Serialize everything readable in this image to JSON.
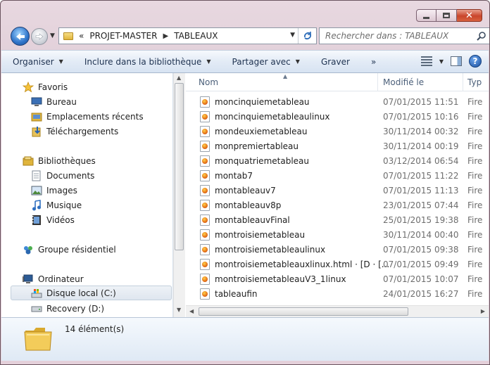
{
  "address": {
    "chevrons": "«",
    "crumbs": [
      "PROJET-MASTER",
      "TABLEAUX"
    ]
  },
  "search": {
    "placeholder": "Rechercher dans : TABLEAUX"
  },
  "toolbar": {
    "organize": "Organiser",
    "include": "Inclure dans la bibliothèque",
    "share": "Partager avec",
    "burn": "Graver",
    "more": "»"
  },
  "navpane": {
    "favorites": "Favoris",
    "desktop": "Bureau",
    "recent": "Emplacements récents",
    "downloads": "Téléchargements",
    "libraries": "Bibliothèques",
    "documents": "Documents",
    "images": "Images",
    "music": "Musique",
    "videos": "Vidéos",
    "homegroup": "Groupe résidentiel",
    "computer": "Ordinateur",
    "local_disk": "Disque local (C:)",
    "recovery": "Recovery (D:)"
  },
  "columns": {
    "name": "Nom",
    "modified": "Modifié le",
    "type": "Typ"
  },
  "files": [
    {
      "name": "moncinquiemetableau",
      "date": "07/01/2015 11:51",
      "type": "Fire"
    },
    {
      "name": "moncinquiemetableaulinux",
      "date": "07/01/2015 10:16",
      "type": "Fire"
    },
    {
      "name": "mondeuxiemetableau",
      "date": "30/11/2014 00:32",
      "type": "Fire"
    },
    {
      "name": "monpremiertableau",
      "date": "30/11/2014 00:19",
      "type": "Fire"
    },
    {
      "name": "monquatriemetableau",
      "date": "03/12/2014 06:54",
      "type": "Fire"
    },
    {
      "name": "montab7",
      "date": "07/01/2015 11:22",
      "type": "Fire"
    },
    {
      "name": "montableauv7",
      "date": "07/01/2015 11:13",
      "type": "Fire"
    },
    {
      "name": "montableauv8p",
      "date": "23/01/2015 07:44",
      "type": "Fire"
    },
    {
      "name": "montableauvFinal",
      "date": "25/01/2015 19:38",
      "type": "Fire"
    },
    {
      "name": "montroisiemetableau",
      "date": "30/11/2014 00:40",
      "type": "Fire"
    },
    {
      "name": "montroisiemetableaulinux",
      "date": "07/01/2015 09:38",
      "type": "Fire"
    },
    {
      "name": "montroisiemetableauxlinux.html · [D · [...",
      "date": "07/01/2015 09:49",
      "type": "Fire"
    },
    {
      "name": "montroisiemetableauV3_1linux",
      "date": "07/01/2015 10:07",
      "type": "Fire"
    },
    {
      "name": "tableaufin",
      "date": "24/01/2015 16:27",
      "type": "Fire"
    }
  ],
  "status": {
    "count": "14 élément(s)"
  },
  "colors": {
    "accent": "#2f74c9",
    "selection": "#dfe6ef"
  }
}
